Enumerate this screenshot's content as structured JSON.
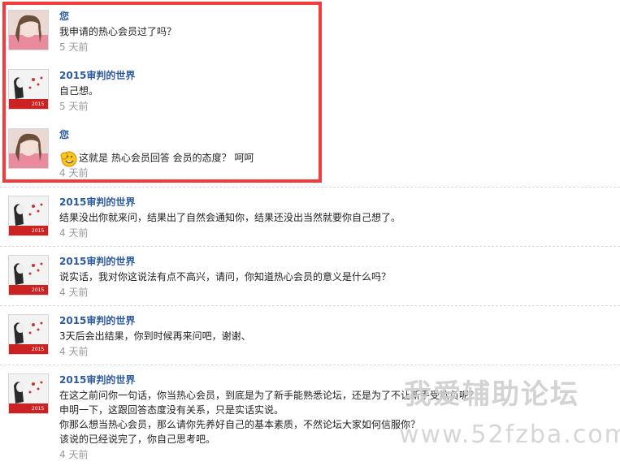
{
  "messages": [
    {
      "user": "您",
      "avatar": "girl-avatar",
      "lines": [
        "我申请的热心会员过了吗？"
      ],
      "time": "5 天前"
    },
    {
      "user": "2015审判的世界",
      "avatar": "art-avatar",
      "lines": [
        "自己想。"
      ],
      "time": "5 天前"
    },
    {
      "user": "您",
      "avatar": "girl-avatar",
      "lines": [
        "这就是 热心会员回答 会员的态度？  呵呵"
      ],
      "time": "4 天前",
      "emoji": "laughing-smiley-icon"
    },
    {
      "user": "2015审判的世界",
      "avatar": "art-avatar",
      "lines": [
        "结果没出你就来问，结果出了自然会通知你，结果还没出当然就要你自己想了。"
      ],
      "time": "4 天前"
    },
    {
      "user": "2015审判的世界",
      "avatar": "art-avatar",
      "lines": [
        "说实话，我对你这说法有点不高兴，请问，你知道热心会员的意义是什么吗？"
      ],
      "time": "4 天前"
    },
    {
      "user": "2015审判的世界",
      "avatar": "art-avatar",
      "lines": [
        "3天后会出结果，你到时候再来问吧，谢谢、"
      ],
      "time": "4 天前"
    },
    {
      "user": "2015审判的世界",
      "avatar": "art-avatar",
      "lines": [
        "在这之前问你一句话，你当热心会员，到底是为了新手能熟悉论坛，还是为了不让新手受欺负呢？",
        "申明一下，这跟回答态度没有关系，只是实话实说。",
        "你那么想当热心会员，那么请你先养好自己的基本素质，不然论坛大家如何信服你？",
        "该说的已经说完了，你自己思考吧。"
      ],
      "time": "4 天前"
    }
  ],
  "watermark": {
    "cn": "我爱辅助论坛",
    "url": "www.52fzba.com"
  },
  "colors": {
    "highlight": "#f23b3b",
    "username": "#2c5aa0",
    "time": "#999999"
  }
}
